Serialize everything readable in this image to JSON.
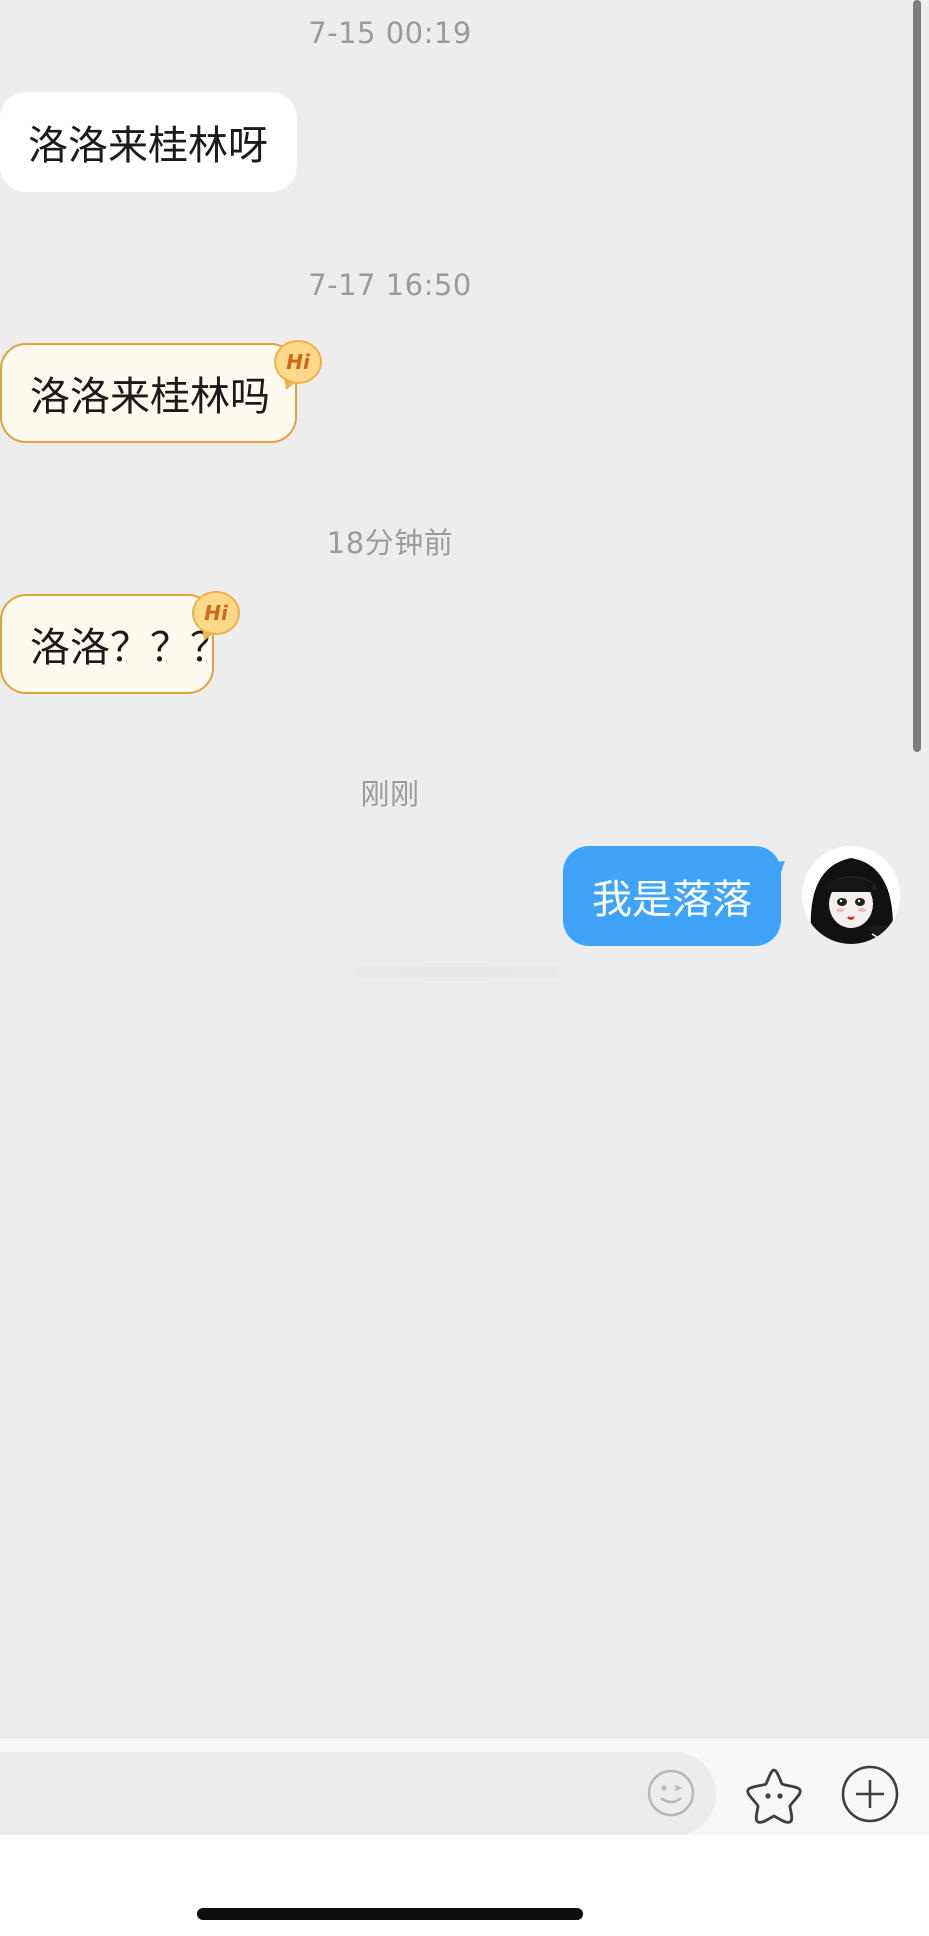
{
  "messages": [
    {
      "timestamp": "7-15 00:19",
      "side": "left",
      "text": "洛洛来桂林呀",
      "style": "plain"
    },
    {
      "timestamp": "7-17 16:50",
      "side": "left",
      "text": "洛洛来桂林吗",
      "style": "hi",
      "badge": "Hi"
    },
    {
      "timestamp": "18分钟前",
      "side": "left",
      "text": "洛洛？？？",
      "style": "hi",
      "badge": "Hi"
    },
    {
      "timestamp": "刚刚",
      "side": "right",
      "text": "我是落落",
      "style": "self"
    }
  ],
  "input_bar": {
    "icons": [
      "emoji-icon",
      "star-icon",
      "plus-icon"
    ]
  },
  "colors": {
    "background": "#ededed",
    "self_bubble": "#3fa3f7",
    "hi_border": "#e0a23a",
    "timestamp": "#9b9b9b"
  }
}
